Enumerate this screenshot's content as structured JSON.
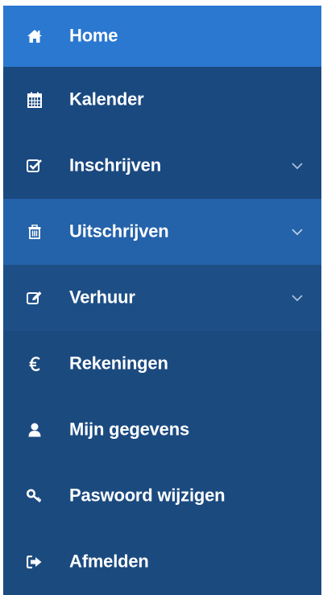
{
  "sidebar": {
    "items": [
      {
        "label": "Home",
        "icon": "home-icon",
        "has_submenu": false,
        "active": true
      },
      {
        "label": "Kalender",
        "icon": "calendar-icon",
        "has_submenu": false,
        "active": false
      },
      {
        "label": "Inschrijven",
        "icon": "check-square-icon",
        "has_submenu": true,
        "active": false
      },
      {
        "label": "Uitschrijven",
        "icon": "trash-icon",
        "has_submenu": true,
        "active": false
      },
      {
        "label": "Verhuur",
        "icon": "edit-icon",
        "has_submenu": true,
        "active": false
      },
      {
        "label": "Rekeningen",
        "icon": "euro-icon",
        "has_submenu": false,
        "active": false
      },
      {
        "label": "Mijn gegevens",
        "icon": "user-icon",
        "has_submenu": false,
        "active": false
      },
      {
        "label": "Paswoord wijzigen",
        "icon": "key-icon",
        "has_submenu": false,
        "active": false
      },
      {
        "label": "Afmelden",
        "icon": "sign-out-icon",
        "has_submenu": false,
        "active": false
      }
    ]
  },
  "colors": {
    "active_bg": "#2b78d1",
    "nav_bg": "#1d4f86",
    "hover_bg": "#2462aa",
    "text": "#ffffff"
  }
}
